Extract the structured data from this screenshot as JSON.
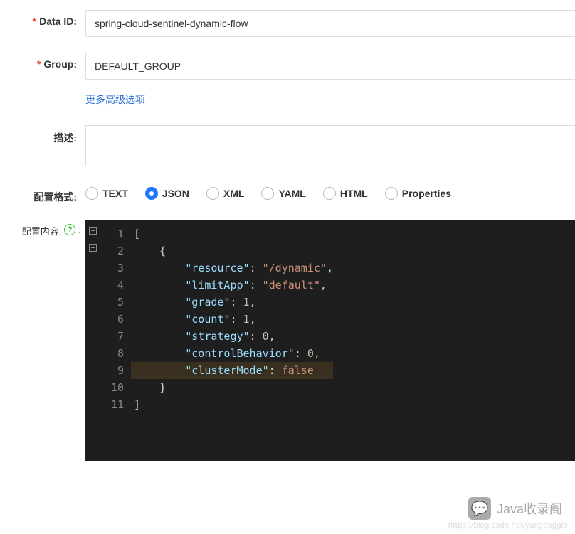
{
  "form": {
    "dataId": {
      "label": "Data ID:",
      "value": "spring-cloud-sentinel-dynamic-flow",
      "required": true
    },
    "group": {
      "label": "Group:",
      "value": "DEFAULT_GROUP",
      "required": true
    },
    "moreOptionsLink": "更多高级选项",
    "description": {
      "label": "描述:",
      "value": ""
    },
    "format": {
      "label": "配置格式:",
      "selected": "JSON",
      "options": [
        "TEXT",
        "JSON",
        "XML",
        "YAML",
        "HTML",
        "Properties"
      ]
    },
    "content": {
      "label": "配置内容:",
      "helpIcon": "?",
      "code": {
        "lines": [
          {
            "n": 1,
            "fold": true,
            "tokens": [
              {
                "t": "[",
                "c": "p"
              }
            ]
          },
          {
            "n": 2,
            "fold": true,
            "tokens": [
              {
                "t": "    ",
                "c": "p"
              },
              {
                "t": "{",
                "c": "p"
              }
            ]
          },
          {
            "n": 3,
            "tokens": [
              {
                "t": "        ",
                "c": "p"
              },
              {
                "t": "\"resource\"",
                "c": "k"
              },
              {
                "t": ": ",
                "c": "p"
              },
              {
                "t": "\"/dynamic\"",
                "c": "s"
              },
              {
                "t": ",",
                "c": "p"
              }
            ]
          },
          {
            "n": 4,
            "tokens": [
              {
                "t": "        ",
                "c": "p"
              },
              {
                "t": "\"limitApp\"",
                "c": "k"
              },
              {
                "t": ": ",
                "c": "p"
              },
              {
                "t": "\"default\"",
                "c": "s"
              },
              {
                "t": ",",
                "c": "p"
              }
            ]
          },
          {
            "n": 5,
            "tokens": [
              {
                "t": "        ",
                "c": "p"
              },
              {
                "t": "\"grade\"",
                "c": "k"
              },
              {
                "t": ": ",
                "c": "p"
              },
              {
                "t": "1",
                "c": "n"
              },
              {
                "t": ",",
                "c": "p"
              }
            ]
          },
          {
            "n": 6,
            "tokens": [
              {
                "t": "        ",
                "c": "p"
              },
              {
                "t": "\"count\"",
                "c": "k"
              },
              {
                "t": ": ",
                "c": "p"
              },
              {
                "t": "1",
                "c": "n"
              },
              {
                "t": ",",
                "c": "p"
              }
            ]
          },
          {
            "n": 7,
            "tokens": [
              {
                "t": "        ",
                "c": "p"
              },
              {
                "t": "\"strategy\"",
                "c": "k"
              },
              {
                "t": ": ",
                "c": "p"
              },
              {
                "t": "0",
                "c": "n"
              },
              {
                "t": ",",
                "c": "p"
              }
            ]
          },
          {
            "n": 8,
            "tokens": [
              {
                "t": "        ",
                "c": "p"
              },
              {
                "t": "\"controlBehavior\"",
                "c": "k"
              },
              {
                "t": ": ",
                "c": "p"
              },
              {
                "t": "0",
                "c": "n"
              },
              {
                "t": ",",
                "c": "p"
              }
            ]
          },
          {
            "n": 9,
            "hl": true,
            "tokens": [
              {
                "t": "        ",
                "c": "p"
              },
              {
                "t": "\"clusterMode\"",
                "c": "k"
              },
              {
                "t": ": ",
                "c": "p"
              },
              {
                "t": "false",
                "c": "b"
              }
            ]
          },
          {
            "n": 10,
            "tokens": [
              {
                "t": "    ",
                "c": "p"
              },
              {
                "t": "}",
                "c": "p"
              }
            ]
          },
          {
            "n": 11,
            "tokens": [
              {
                "t": "]",
                "c": "p"
              }
            ]
          }
        ]
      }
    }
  },
  "watermark": {
    "logoGlyph": "💬",
    "text": "Java收录阁",
    "url": "https://blog.csdn.net/yangbaggio"
  }
}
